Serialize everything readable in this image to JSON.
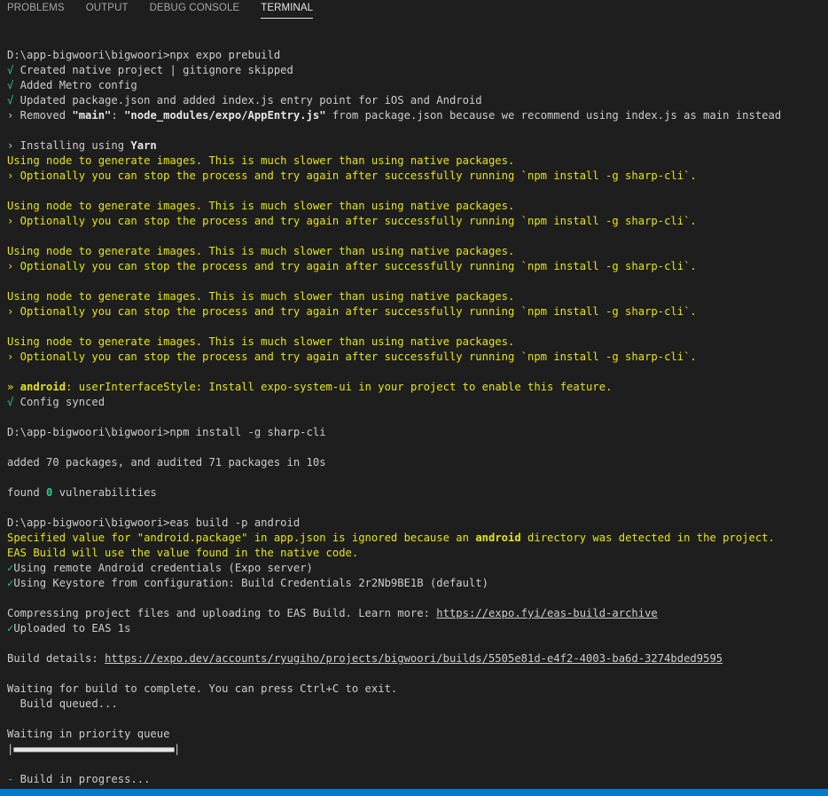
{
  "tabs": [
    {
      "label": "PROBLEMS",
      "active": false
    },
    {
      "label": "OUTPUT",
      "active": false
    },
    {
      "label": "DEBUG CONSOLE",
      "active": false
    },
    {
      "label": "TERMINAL",
      "active": true
    }
  ],
  "terminal": {
    "prompt1": "D:\\app-bigwoori\\bigwoori>npx expo prebuild",
    "check": "√",
    "created": " Created native project | gitignore skipped",
    "metro": " Added Metro config",
    "updated": " Updated package.json and added index.js entry point for iOS and Android",
    "removed_a": "› Removed ",
    "removed_main": "\"main\"",
    "removed_colon": ": ",
    "removed_path": "\"node_modules/expo/AppEntry.js\"",
    "removed_b": " from package.json because we recommend using index.js as main instead",
    "installing": "› Installing using ",
    "yarn": "Yarn",
    "node_slow": "Using node to generate images. This is much slower than using native packages.",
    "optionally": "› Optionally you can stop the process and try again after successfully running `npm install -g sharp-cli`.",
    "android_prefix": "» ",
    "android_word": "android",
    "android_rest": ": userInterfaceStyle: Install expo-system-ui in your project to enable this feature.",
    "config_synced": " Config synced",
    "prompt2": "D:\\app-bigwoori\\bigwoori>npm install -g sharp-cli",
    "added": "added 70 packages, and audited 71 packages in 10s",
    "found_a": "found ",
    "found_zero": "0",
    "found_b": " vulnerabilities",
    "prompt3": "D:\\app-bigwoori\\bigwoori>eas build -p android",
    "specified_a": "Specified value for \"android.package\" in app.json is ignored because an ",
    "specified_android": "android",
    "specified_b": " directory was detected in the project.",
    "eas_native": "EAS Build will use the value found in the native code.",
    "check2": "✓",
    "remote_creds": "Using remote Android credentials (Expo server)",
    "keystore": "Using Keystore from configuration: Build Credentials 2r2Nb9BE1B (default)",
    "compressing": "Compressing project files and uploading to EAS Build. Learn more: ",
    "archive_link": "https://expo.fyi/eas-build-archive",
    "uploaded": "Uploaded to EAS 1s",
    "build_details": "Build details: ",
    "build_link": "https://expo.dev/accounts/ryugiho/projects/bigwoori/builds/5505e81d-e4f2-4003-ba6d-3274bded9595",
    "waiting": "Waiting for build to complete. You can press Ctrl+C to exit.",
    "queued": "  Build queued...",
    "priority": "Waiting in priority queue",
    "bar_left": "|",
    "bar_fill": "■■■■■■■■■■■■■■■■■■■■■■■■■■■■■■■■■■■■■■■■",
    "bar_right": "|",
    "spinner": "-",
    "in_progress": " Build in progress..."
  },
  "colors": {
    "background": "#1e1e1e",
    "text": "#cccccc",
    "yellow": "#e5e510",
    "green": "#23d18b",
    "statusbar": "#007acc"
  }
}
